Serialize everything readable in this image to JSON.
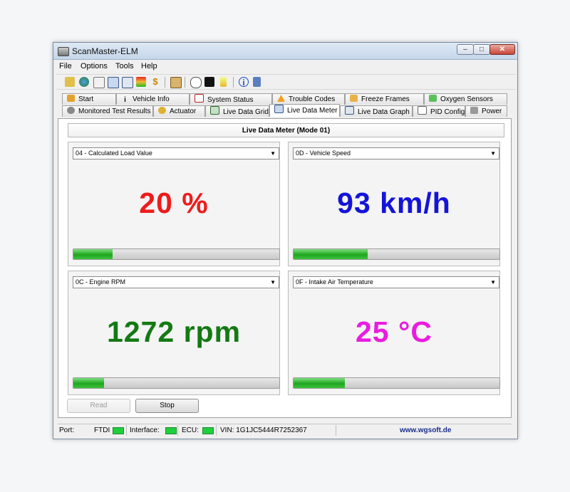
{
  "window": {
    "title": "ScanMaster-ELM"
  },
  "menu": [
    "File",
    "Options",
    "Tools",
    "Help"
  ],
  "toolbar_icons": [
    "wand-icon",
    "globe-icon",
    "document-icon",
    "grid-icon",
    "chart-icon",
    "traffic-light-icon",
    "dollar-icon",
    "clipboard-icon",
    "speech-bubble-icon",
    "terminal-icon",
    "battery-icon",
    "info-icon",
    "exit-icon"
  ],
  "tabs_row1": [
    "Start",
    "Vehicle Info",
    "System Status",
    "Trouble Codes",
    "Freeze Frames",
    "Oxygen Sensors"
  ],
  "tabs_row2": [
    "Monitored Test Results",
    "Actuator",
    "Live Data Grid",
    "Live Data Meter",
    "Live Data Graph",
    "PID Config",
    "Power"
  ],
  "active_tab": "Live Data Meter",
  "header": "Live Data Meter (Mode 01)",
  "gauges": [
    {
      "pid": "04 - Calculated Load Value",
      "value": "20 %",
      "color": "#ee1c1c",
      "level": 0.19
    },
    {
      "pid": "0D - Vehicle Speed",
      "value": "93 km/h",
      "color": "#1414d8",
      "level": 0.36
    },
    {
      "pid": "0C - Engine RPM",
      "value": "1272 rpm",
      "color": "#137a13",
      "level": 0.15
    },
    {
      "pid": "0F - Intake Air Temperature",
      "value": "25 °C",
      "color": "#ea1ce0",
      "level": 0.25
    }
  ],
  "buttons": {
    "read": "Read",
    "stop": "Stop"
  },
  "status": {
    "port_label": "Port:",
    "ftdi_label": "FTDI",
    "interface_label": "Interface:",
    "ecu_label": "ECU:",
    "vin": "VIN: 1G1JC5444R7252367",
    "website": "www.wgsoft.de",
    "led_color": "#1fcf3c"
  }
}
